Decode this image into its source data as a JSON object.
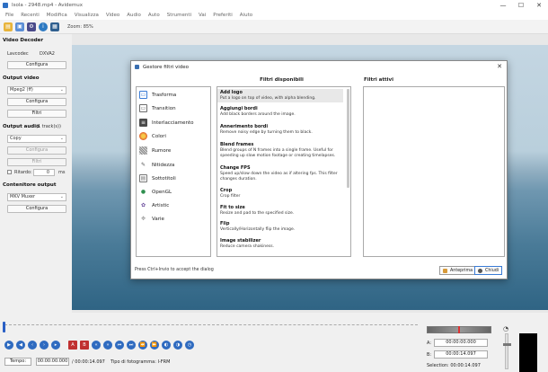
{
  "window": {
    "title": "Isola - 2948.mp4 - Avidemux",
    "controls": [
      "—",
      "☐",
      "✕"
    ]
  },
  "menu": [
    "File",
    "Recenti",
    "Modifica",
    "Visualizza",
    "Video",
    "Audio",
    "Auto",
    "Strumenti",
    "Vai",
    "Preferiti",
    "Aiuto"
  ],
  "toolbar": {
    "zoom": "Zoom: 85%"
  },
  "sidebar": {
    "video_decoder": {
      "title": "Video Decoder",
      "label": "Lavcodec",
      "value": "DXVA2",
      "configure": "Configura"
    },
    "video_output": {
      "title": "Output video",
      "codec": "Mpeg2 (ff)",
      "configure": "Configura",
      "filters": "Filtri"
    },
    "audio_output": {
      "title": "Output audio",
      "tracks": "(1 track(s))",
      "codec": "Copy",
      "configure": "Configura",
      "filters": "Filtri",
      "shift_label": "Ritardo:",
      "shift_value": "0",
      "shift_unit": "ms"
    },
    "container": {
      "title": "Contenitore output",
      "format": "MKV Muxer",
      "configure": "Configura"
    }
  },
  "dialog": {
    "title": "Gestore filtri video",
    "available_header": "Filtri disponibili",
    "active_header": "Filtri attivi",
    "categories": [
      {
        "label": "Trasforma",
        "icon": "transform-icon",
        "color": "#3a7bd5"
      },
      {
        "label": "Transition",
        "icon": "transition-icon",
        "color": "#6b6b6b"
      },
      {
        "label": "Interlacciamento",
        "icon": "interlace-icon",
        "color": "#4a4a4a"
      },
      {
        "label": "Colori",
        "icon": "colors-icon",
        "color": "#e05c2a"
      },
      {
        "label": "Rumore",
        "icon": "noise-icon",
        "color": "#888888"
      },
      {
        "label": "Nitidezza",
        "icon": "sharpness-icon",
        "color": "#555555"
      },
      {
        "label": "Sottotitoli",
        "icon": "subtitles-icon",
        "color": "#777777"
      },
      {
        "label": "OpenGL",
        "icon": "opengl-icon",
        "color": "#2f8f4f"
      },
      {
        "label": "Artistic",
        "icon": "artistic-icon",
        "color": "#6a4c9c"
      },
      {
        "label": "Varie",
        "icon": "misc-icon",
        "color": "#999999"
      }
    ],
    "filters": [
      {
        "name": "Add logo",
        "desc": "Put a logo on top of video, with alpha blending."
      },
      {
        "name": "Aggiungi bordi",
        "desc": "Add black borders around the image."
      },
      {
        "name": "Annerimento bordi",
        "desc": "Remove noisy edge by turning them to black."
      },
      {
        "name": "Blend frames",
        "desc": "Blend groups of N frames into a single frame. Useful for speeding up slow motion footage or creating timelapses."
      },
      {
        "name": "Change FPS",
        "desc": "Speed up/slow down the video as if altering fps. This filter changes duration."
      },
      {
        "name": "Crop",
        "desc": "Crop filter"
      },
      {
        "name": "Fit to size",
        "desc": "Resize and pad to the specified size."
      },
      {
        "name": "Flip",
        "desc": "Vertically/Horizontally flip the image."
      },
      {
        "name": "Image stabilizer",
        "desc": "Reduce camera shakiness."
      }
    ],
    "hint": "Press Ctrl+Invio to accept the dialog",
    "preview_button": "Anteprima",
    "close_button": "Chiudi"
  },
  "timeline": {
    "time_label": "Tempo:",
    "current_time": "00:00:00.000",
    "total_time": "/ 00:00:14.097",
    "frame_type": "Tipo di fotogramma:  I-FRM",
    "a_label": "A:",
    "a_value": "00:00:00.000",
    "b_label": "B:",
    "b_value": "00:00:14.097",
    "selection": "Selection: 00:00:14.097"
  },
  "colors": {
    "accent": "#2f6bc0",
    "mark": "#c03030"
  }
}
